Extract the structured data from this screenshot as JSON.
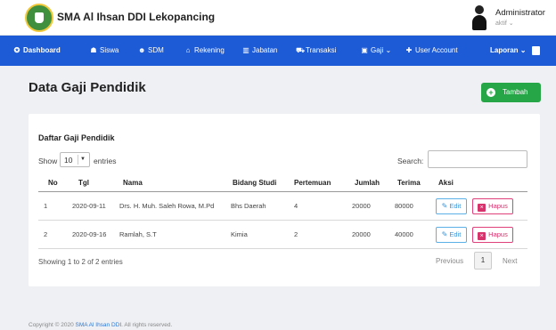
{
  "header": {
    "brand": "SMA Al Ihsan DDI Lekopancing",
    "user_name": "Administrator",
    "user_status": "aktif ⌄"
  },
  "nav": {
    "items": [
      {
        "icon": "gauge-icon",
        "glyph": "✪",
        "label": "Dashboard"
      },
      {
        "icon": "users-icon",
        "glyph": "☗",
        "label": "Siswa"
      },
      {
        "icon": "user-icon",
        "glyph": "☻",
        "label": "SDM"
      },
      {
        "icon": "bank-icon",
        "glyph": "⌂",
        "label": "Rekening"
      },
      {
        "icon": "chart-icon",
        "glyph": "▥",
        "label": "Jabatan"
      },
      {
        "icon": "cart-icon",
        "glyph": "⛟",
        "label": "Transaksi"
      },
      {
        "icon": "money-icon",
        "glyph": "▣",
        "label": "Gaji ⌄"
      },
      {
        "icon": "user-plus-icon",
        "glyph": "✚",
        "label": "User Account"
      }
    ],
    "report": "Laporan ⌄"
  },
  "page": {
    "title": "Data Gaji Pendidik",
    "add_button": "Tambah"
  },
  "table_card": {
    "title": "Daftar Gaji Pendidik",
    "show_label": "Show",
    "entries_value": "10",
    "entries_label": "entries",
    "search_label": "Search:",
    "search_value": "",
    "columns": [
      "No",
      "Tgl",
      "Nama",
      "Bidang Studi",
      "Pertemuan",
      "Jumlah",
      "Terima",
      "Aksi"
    ],
    "rows": [
      {
        "no": "1",
        "tgl": "2020-09-11",
        "nama": "Drs. H. Muh. Saleh Rowa, M.Pd",
        "bidang": "Bhs Daerah",
        "pertemuan": "4",
        "jumlah": "20000",
        "terima": "80000"
      },
      {
        "no": "2",
        "tgl": "2020-09-16",
        "nama": "Ramlah, S.T",
        "bidang": "Kimia",
        "pertemuan": "2",
        "jumlah": "20000",
        "terima": "40000"
      }
    ],
    "edit_label": "Edit",
    "delete_label": "Hapus",
    "info": "Showing 1 to 2 of 2 entries",
    "pagination": {
      "previous": "Previous",
      "page": "1",
      "next": "Next"
    }
  },
  "footer": {
    "prefix": "Copyright © 2020 ",
    "brand": "SMA Al Ihsan DDI",
    "suffix": ". All rights reserved."
  },
  "colors": {
    "navbar": "#1d5bd6",
    "add_button": "#27a648",
    "edit": "#3a95d8",
    "delete": "#d6336c"
  }
}
